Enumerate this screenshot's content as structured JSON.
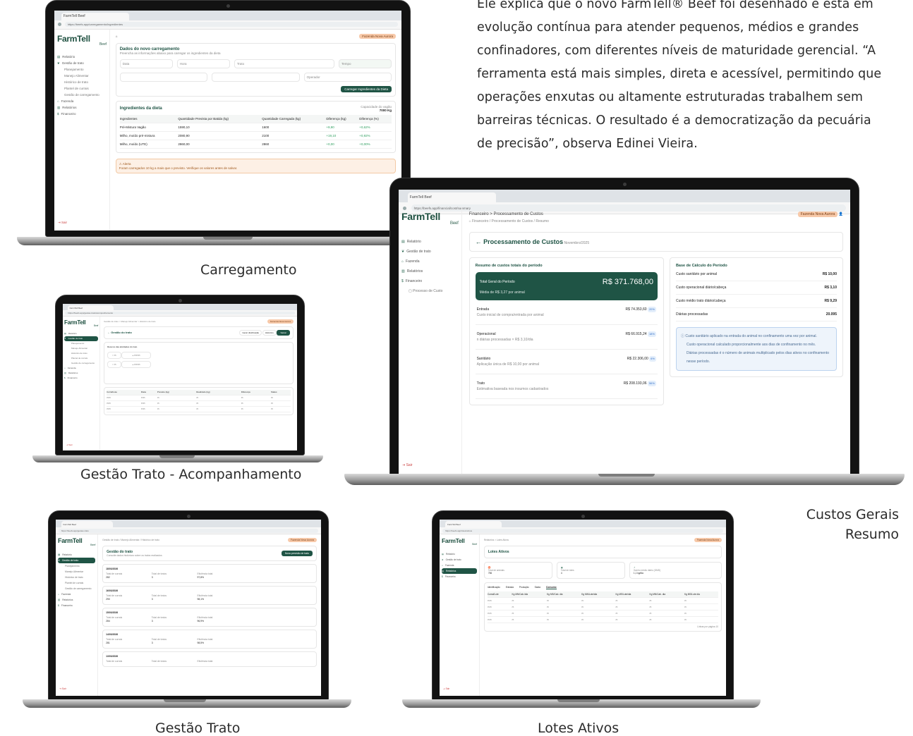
{
  "article": {
    "lines": [
      "Ele explica que o novo FarmTell® Beef foi desenhado e está em",
      "evolução contínua para atender pequenos, médios e grandes",
      "confinadores, com diferentes níveis de maturidade gerencial. “A",
      "ferramenta está mais simples, direta e acessível, permitindo que",
      "operações enxutas ou altamente estruturadas trabalhem sem",
      "barreiras técnicas. O resultado é a democratização da pecuária",
      "de precisão”, observa Edinei Vieira."
    ]
  },
  "captions": {
    "carregamento": "Carregamento",
    "gestao_acompanhamento": "Gestão Trato - Acompanhamento",
    "custos_line1": "Custos Gerais",
    "custos_line2": "Resumo",
    "gestao_trato": "Gestão Trato",
    "lotes_ativos": "Lotes Ativos"
  },
  "common": {
    "logo": "FarmTell",
    "logo_sub": "Beef",
    "tab_title": "FarmTell Beef",
    "sair": "Sair",
    "company_pill": "Fazenda Nova Aurora"
  },
  "carregamento": {
    "url": "https://beefs.app/carregamento/ingredientes",
    "nav": [
      "Relatório",
      "Gestão de trato",
      "Planejamento",
      "Manejo Alimentar",
      "Histórico de trato",
      "Plantel de currais",
      "Gestão de carregamento",
      "Fazenda",
      "Relatórios",
      "Financeiro"
    ],
    "title": "Dados do novo carregamento",
    "subtitle": "Preencha as informações abaixo para carregar os ingredientes da dieta",
    "fields": [
      "Data",
      "Hora",
      "Trato",
      "Tempo",
      "Operador"
    ],
    "load_button": "Carregar Ingredientes da Dieta",
    "ingredients_title": "Ingredientes da dieta",
    "capacity_label": "Capacidade do vagão",
    "capacity_value": "7000 Kg",
    "columns": [
      "Ingredientes",
      "Quantidade Prevista por Batida (kg)",
      "Quantidade Carregada (kg)",
      "Diferença (kg)",
      "Diferença (%)"
    ],
    "rows": [
      [
        "Pré-Mistura Vagão",
        "1590,10",
        "1600",
        "+9,90",
        "+0,62%"
      ],
      [
        "Milho, moído pré-mistura",
        "2080,90",
        "2100",
        "+19,10",
        "+0,92%"
      ],
      [
        "Milho, moído (UTE)",
        "2860,00",
        "2860",
        "+0,00",
        "+0,00%"
      ]
    ],
    "alert_title": "Alerta",
    "alert_text": "Foram carregados 10 kg a mais que o previsto. Verifique os valores antes de salvar."
  },
  "acompanhamento": {
    "url": "https://beefs.app/gestao-trato/acompanhamento",
    "breadcrumb": "Gestão de trato > Manejo Alimentar > Histórico de trato",
    "title": "Gestão do trato",
    "buttons": [
      "Gerar distribuição",
      "Histórico",
      "Salvar"
    ],
    "section": "Resumo das atividades do trato",
    "columns": [
      "Curral/Lote",
      "Dieta",
      "Previsto (kg)",
      "Realizado (kg)",
      "Diferença",
      "Status"
    ]
  },
  "custos": {
    "url": "https://beefs.app/financial/cost/summary",
    "page_header": "Financeiro > Processamento de Custos",
    "breadcrumb": "Financeiro / Processamento de Custos / Resumo",
    "nav": [
      "Relatório",
      "Gestão de trato",
      "Fazenda",
      "Relatórios",
      "Financeiro",
      "Processo de Custo"
    ],
    "title": "Processamento de Custos",
    "period": "Novembro/2025",
    "summary_title": "Resumo de custos totais do período",
    "total_label": "Total Geral do Período",
    "total_value": "R$ 371.768,00",
    "total_sub": "Média de R$ 3,27 por animal",
    "items": [
      {
        "label": "Entrada",
        "desc": "Custo inicial de compra/entrada por animal",
        "value": "R$ 74.353,60",
        "chip": "20%",
        "chip_color": "#3a74c9"
      },
      {
        "label": "Operacional",
        "desc": "n diárias processadas × R$ 3,10/dia",
        "value": "R$ 66.915,24",
        "chip": "18%",
        "chip_color": "#3a74c9"
      },
      {
        "label": "Sanitário",
        "desc": "Aplicação única de R$ 10,00 por animal",
        "value": "R$ 22.306,00",
        "chip": "6%",
        "chip_color": "#3a74c9"
      },
      {
        "label": "Trato",
        "desc": "Estimativa baseada nos insumos cadastrados",
        "value": "R$ 208.193,06",
        "chip": "56%",
        "chip_color": "#3a74c9"
      }
    ],
    "base_title": "Base de Cálculo do Período",
    "base_items": [
      {
        "label": "Custo sanitário por animal",
        "value": "R$ 10,00"
      },
      {
        "label": "Custo operacional diário/cabeça",
        "value": "R$ 3,10"
      },
      {
        "label": "Custo médio trato diário/cabeça",
        "value": "R$ 9,29"
      },
      {
        "label": "Diárias processadas",
        "value": "20.095"
      }
    ],
    "info_lines": [
      "Custo sanitário aplicado na entrada do animal no confinamento uma vez por animal.",
      "Custo operacional calculado proporcionalmente aos dias de confinamento no mês.",
      "Diárias processadas é o número de animais multiplicado pelos dias ativos no confinamento nesse período."
    ]
  },
  "gestao": {
    "url": "https://beefs.app/gestao-trato",
    "breadcrumb": "Gestão de trato / Manejo Alimentar / Histórico de trato",
    "title": "Gestão do trato",
    "subtitle": "Consulte dados históricos sobre os tratos realizados",
    "button": "Nova previsão de trato",
    "col_labels": [
      "Total de currais",
      "Total de tratos",
      "Eficiência total"
    ],
    "entries": [
      {
        "date": "18/03/2026",
        "values": [
          "282",
          "3",
          "97,8%"
        ]
      },
      {
        "date": "16/03/2026",
        "values": [
          "290",
          "3",
          "98,1%"
        ]
      },
      {
        "date": "15/03/2026",
        "values": [
          "284",
          "3",
          "96,9%"
        ]
      },
      {
        "date": "14/03/2026",
        "values": [
          "281",
          "3",
          "98,5%"
        ]
      },
      {
        "date": "13/03/2026",
        "values": [
          "",
          "",
          ""
        ]
      }
    ]
  },
  "lotes": {
    "url": "https://beefs.app/lotes/ativos",
    "breadcrumb": "Relatórios > Lotes Ativos",
    "title": "Lotes Ativos",
    "cards": [
      "Total de animais",
      "Total de lotes",
      "Ganho médio diário (GMD)"
    ],
    "card_values": [
      "756",
      "4",
      "1,1 kg/dia"
    ],
    "tabs": [
      "Identificação",
      "Entrada",
      "Produção",
      "Saída",
      "Consumo"
    ],
    "columns": [
      "Curral/Lote",
      "Kg MN/Cab./dia",
      "Kg MS/Cab. dia",
      "Kg MN/Lote/dia",
      "Kg MS/Lote/dia",
      "Kg MN/Cab. dia",
      "Kg MS/Lote dia"
    ],
    "footer": "Linhas por página 10"
  }
}
